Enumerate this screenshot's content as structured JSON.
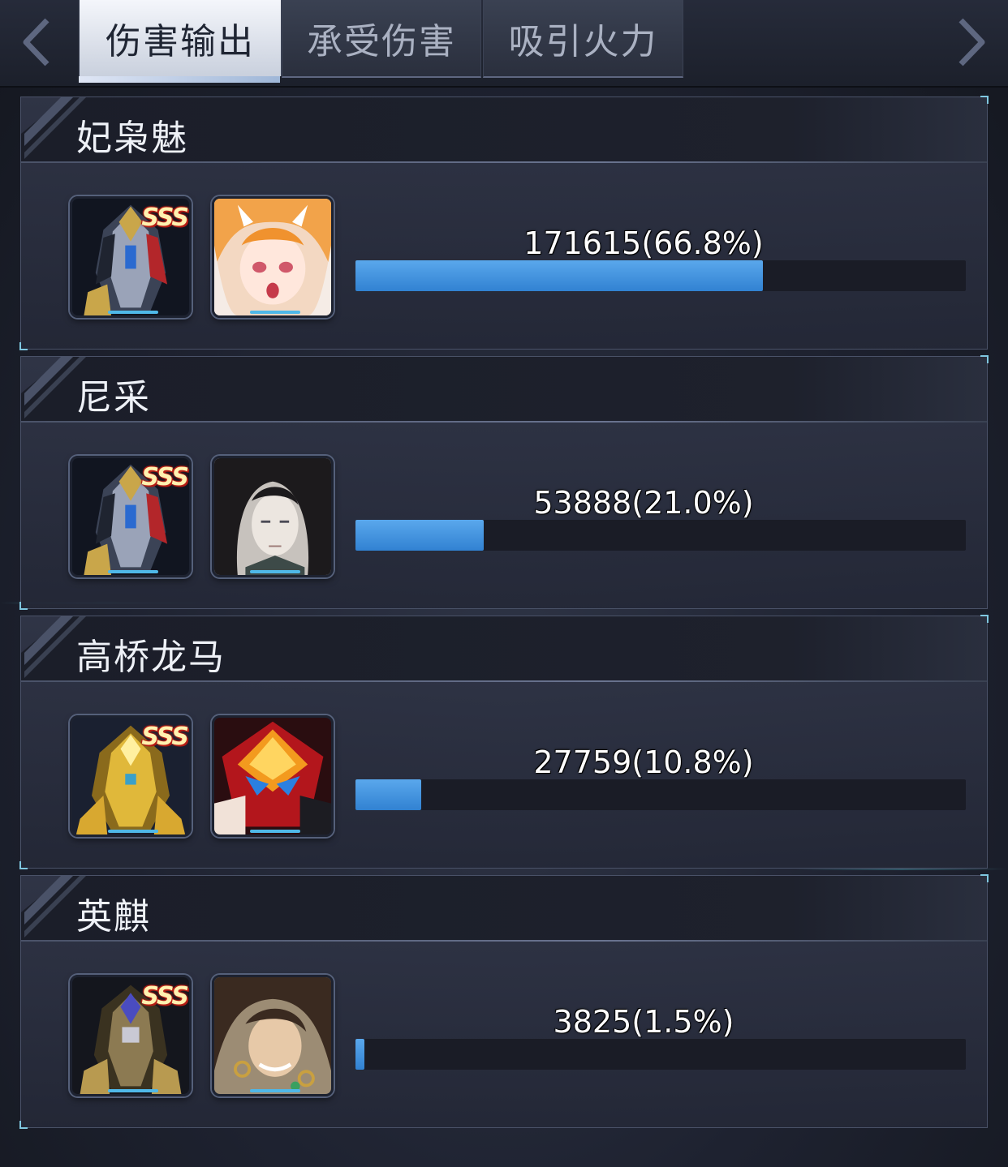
{
  "tabs": [
    {
      "label": "伤害输出",
      "active": true
    },
    {
      "label": "承受伤害",
      "active": false
    },
    {
      "label": "吸引火力",
      "active": false
    }
  ],
  "nav": {
    "left_icon": "chevron-left-icon",
    "right_icon": "chevron-right-icon"
  },
  "accent_color": "#3d8ede",
  "players": [
    {
      "name": "妃枭魅",
      "value": "171615(66.8%)",
      "fraction": 0.668,
      "mech_rank": "SSS",
      "mech_theme": "silver-gold",
      "pilot_theme": "orange-hair"
    },
    {
      "name": "尼采",
      "value": "53888(21.0%)",
      "fraction": 0.21,
      "mech_rank": "SSS",
      "mech_theme": "silver-gold",
      "pilot_theme": "dark-hair"
    },
    {
      "name": "高桥龙马",
      "value": "27759(10.8%)",
      "fraction": 0.108,
      "mech_rank": "SSS",
      "mech_theme": "gold",
      "pilot_theme": "red-crystal"
    },
    {
      "name": "英麒",
      "value": "3825(1.5%)",
      "fraction": 0.015,
      "mech_rank": "SSS",
      "mech_theme": "dark-gold",
      "pilot_theme": "brown-hair"
    }
  ]
}
